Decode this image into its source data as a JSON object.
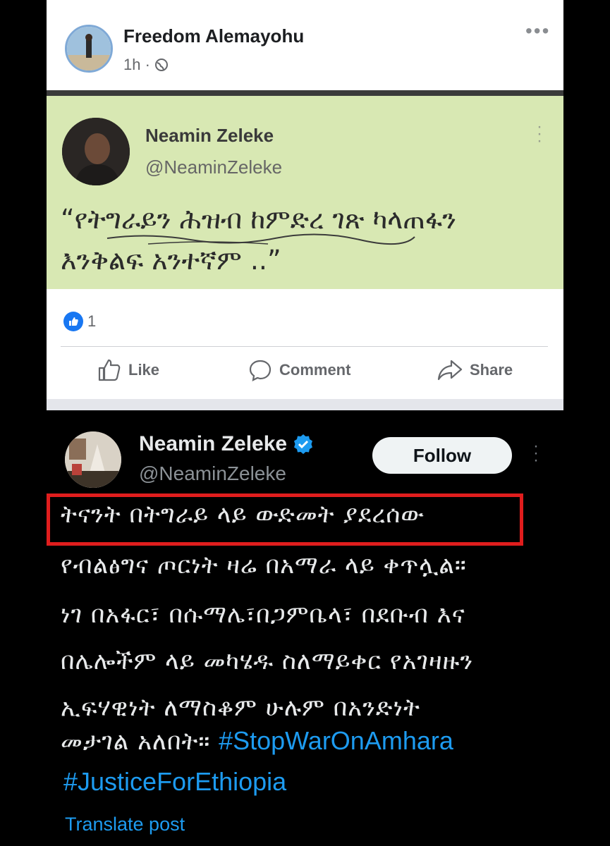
{
  "facebook_post": {
    "author": "Freedom Alemayohu",
    "time": "1h ·",
    "embedded_tweet": {
      "name": "Neamin Zeleke",
      "handle": "@NeaminZeleke",
      "quote_line1": "“የትግራይን ሕዝብ ከምድረ ገጽ ካላጠፋን",
      "quote_line2": "እንቅልፍ አንተኛም ..”"
    },
    "reaction_count": "1",
    "actions": {
      "like": "Like",
      "comment": "Comment",
      "share": "Share"
    }
  },
  "tweet": {
    "name": "Neamin Zeleke",
    "handle": "@NeaminZeleke",
    "follow_label": "Follow",
    "lines": [
      "ትናንት በትግራይ ላይ ውድመት ያደረሰው",
      "የብልፅግና ጦርነት ዛሬ በአማራ ላይ ቀጥሏል።",
      "ነገ በአፋር፣ በሱማሌ፣በጋምቤላ፣ በደቡብ እና",
      "በሌሎችም ላይ መካሄዱ ስለማይቀር የአገዛዙን",
      "ኢፍሃዊነት ለማስቆም ሁሉም በአንድነት",
      "መታገል አለበት።"
    ],
    "hashtag1": "#StopWarOnAmhara",
    "hashtag2": "#JusticeForEthiopia",
    "translate": "Translate post"
  },
  "colors": {
    "facebook_blue": "#1877f2",
    "twitter_blue": "#1d9bf0",
    "highlight_red": "#e01d1d",
    "embed_bg": "#d8e8b3"
  }
}
